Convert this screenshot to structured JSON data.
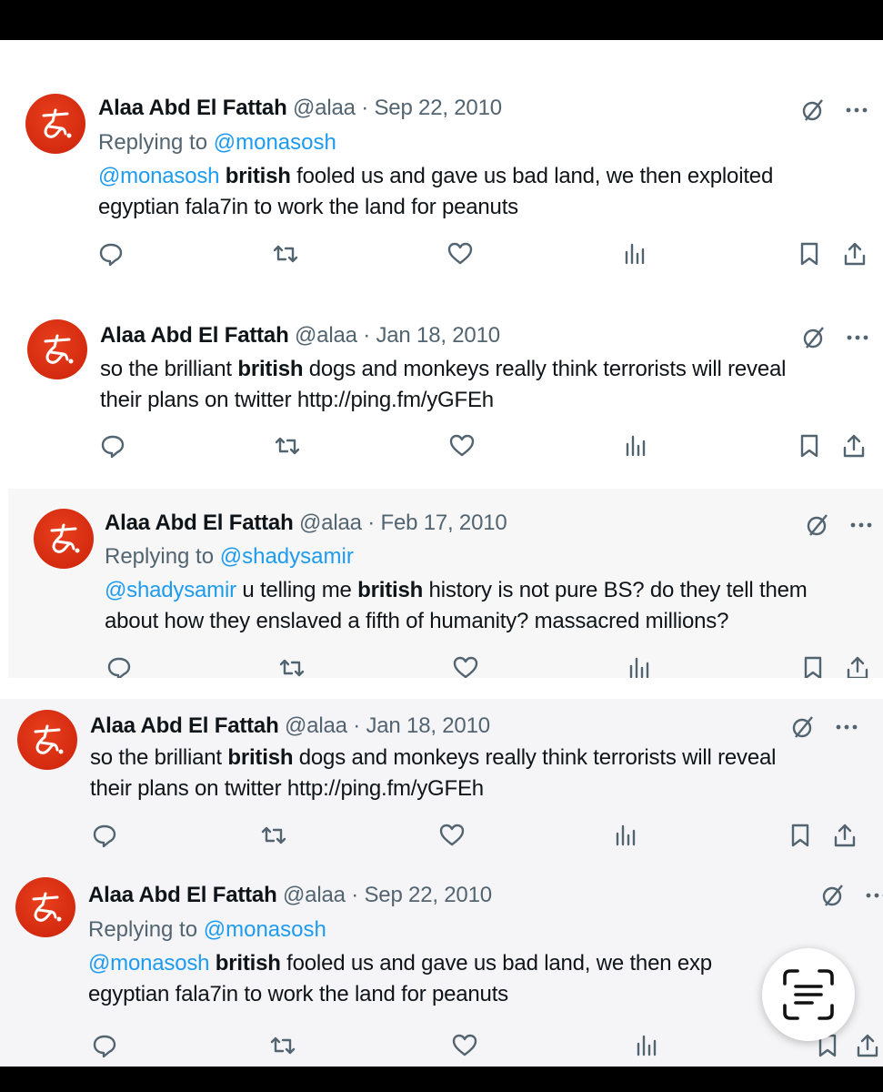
{
  "tweets": [
    {
      "name": "Alaa Abd El Fattah",
      "meta": "@alaa · Sep 22, 2010",
      "reply_prefix": "Replying to ",
      "reply_to": "@monasosh",
      "line1": {
        "mention": "@monasosh ",
        "bold": "british",
        "rest": " fooled us and gave us bad land, we then exploited"
      },
      "line2": "egyptian fala7in to work the land for peanuts"
    },
    {
      "name": "Alaa Abd El Fattah",
      "meta": "@alaa · Jan 18, 2010",
      "line1": {
        "pre": "so the brilliant ",
        "bold": "british",
        "rest": " dogs and monkeys really think terrorists will reveal"
      },
      "line2": "their plans on twitter http://ping.fm/yGFEh"
    },
    {
      "name": "Alaa Abd El Fattah",
      "meta": "@alaa · Feb 17, 2010",
      "reply_prefix": "Replying to ",
      "reply_to": "@shadysamir",
      "line1": {
        "mention": "@shadysamir ",
        "pre": "u telling me ",
        "bold": "british",
        "rest": " history is not pure BS? do they tell them"
      },
      "line2": "about how they enslaved a fifth of humanity? massacred millions?"
    },
    {
      "name": "Alaa Abd El Fattah",
      "meta": "@alaa · Jan 18, 2010",
      "line1": {
        "pre": "so the brilliant ",
        "bold": "british",
        "rest": " dogs and monkeys really think terrorists will reveal"
      },
      "line2": "their plans on twitter http://ping.fm/yGFEh"
    },
    {
      "name": "Alaa Abd El Fattah",
      "meta": "@alaa · Sep 22, 2010",
      "reply_prefix": "Replying to ",
      "reply_to": "@monasosh",
      "line1": {
        "mention": "@monasosh ",
        "bold": "british",
        "rest": " fooled us and gave us bad land, we then exp"
      },
      "line2": "egyptian fala7in to work the land for peanuts"
    }
  ],
  "icons": {
    "grok": "grok-icon",
    "more": "more-icon",
    "reply": "reply-icon",
    "retweet": "retweet-icon",
    "like": "like-icon",
    "views": "views-icon",
    "bookmark": "bookmark-icon",
    "share": "share-icon",
    "scan": "text-scan-icon"
  },
  "colors": {
    "link": "#1d9bf0",
    "muted": "#536471",
    "text": "#0f1419",
    "avatar": "#d42a10"
  }
}
